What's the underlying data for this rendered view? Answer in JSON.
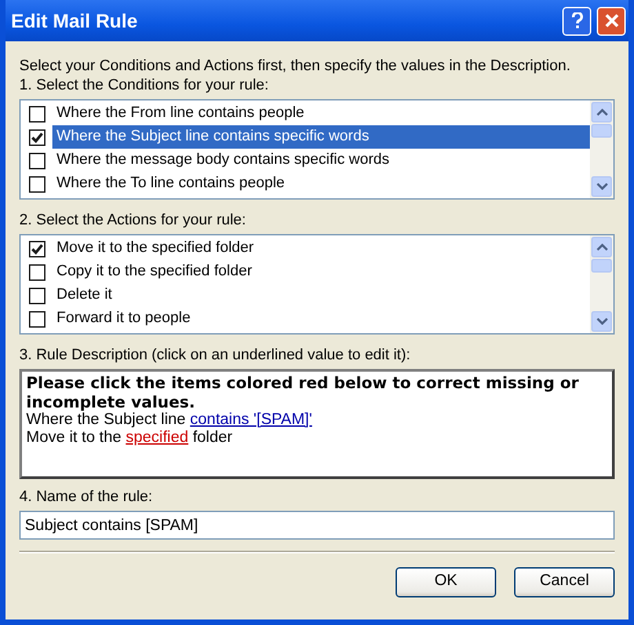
{
  "window": {
    "title": "Edit Mail Rule"
  },
  "intro": "Select your Conditions and Actions first, then specify the values in the Description.",
  "conditions": {
    "label": "1. Select the Conditions for your rule:",
    "items": [
      {
        "text": "Where the From line contains people",
        "checked": false,
        "selected": false
      },
      {
        "text": "Where the Subject line contains specific words",
        "checked": true,
        "selected": true
      },
      {
        "text": "Where the message body contains specific words",
        "checked": false,
        "selected": false
      },
      {
        "text": "Where the To line contains people",
        "checked": false,
        "selected": false
      }
    ]
  },
  "actions": {
    "label": "2. Select the Actions for your rule:",
    "items": [
      {
        "text": "Move it to the specified folder",
        "checked": true,
        "selected": false
      },
      {
        "text": "Copy it to the specified folder",
        "checked": false,
        "selected": false
      },
      {
        "text": "Delete it",
        "checked": false,
        "selected": false
      },
      {
        "text": "Forward it to people",
        "checked": false,
        "selected": false
      }
    ]
  },
  "description": {
    "label": "3. Rule Description (click on an underlined value to edit it):",
    "heading": "Please click the items colored red below to correct missing or incomplete values.",
    "lines": [
      {
        "parts": [
          {
            "kind": "plain",
            "text": "Where the Subject line"
          },
          {
            "kind": "link",
            "text": "contains '[SPAM]'"
          }
        ]
      },
      {
        "parts": [
          {
            "kind": "plain",
            "text": "Move it to the"
          },
          {
            "kind": "missing",
            "text": "specified"
          },
          {
            "kind": "plain",
            "text": "folder"
          }
        ]
      }
    ]
  },
  "rule_name": {
    "label": "4. Name of the rule:",
    "value": "Subject contains [SPAM]"
  },
  "buttons": [
    "OK",
    "Cancel"
  ]
}
